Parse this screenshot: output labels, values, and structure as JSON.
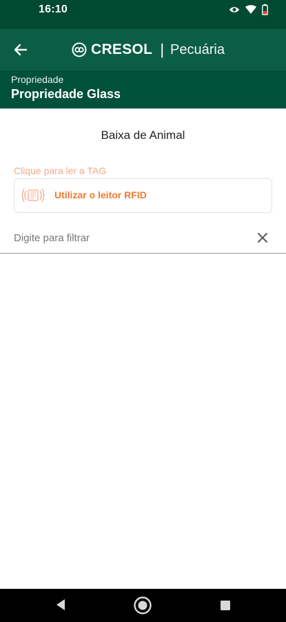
{
  "status": {
    "time": "16:10"
  },
  "app_bar": {
    "brand_name": "CRESOL",
    "separator": "|",
    "section": "Pecuária"
  },
  "property": {
    "label": "Propriedade",
    "name": "Propriedade Glass"
  },
  "page": {
    "title": "Baixa de Animal"
  },
  "tag": {
    "label": "Clique para ler a TAG",
    "rfid_button": "Utilizar o leitor RFID"
  },
  "filter": {
    "placeholder": "Digite para filtrar",
    "value": ""
  },
  "colors": {
    "status_bar": "#004a32",
    "app_bar": "#0b5d44",
    "property_bar": "#005139",
    "accent": "#f07a2f"
  },
  "icons": [
    "back-arrow-icon",
    "cresol-logo-icon",
    "rfid-icon",
    "close-icon",
    "eye-icon",
    "wifi-icon",
    "battery-icon"
  ]
}
